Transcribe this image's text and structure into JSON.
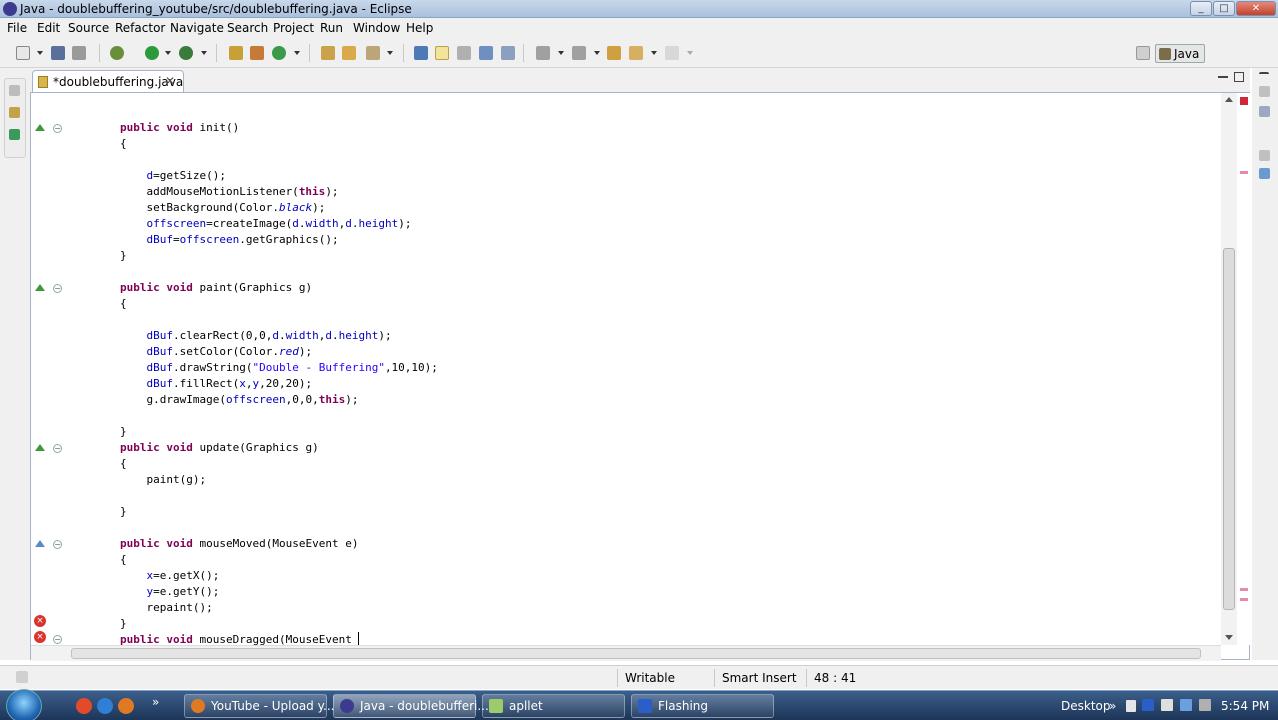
{
  "window": {
    "title": "Java - doublebuffering_youtube/src/doublebuffering.java - Eclipse",
    "minimize": "_",
    "maximize": "□",
    "close": "✕"
  },
  "menu": [
    "File",
    "Edit",
    "Source",
    "Refactor",
    "Navigate",
    "Search",
    "Project",
    "Run",
    "Window",
    "Help"
  ],
  "perspective": {
    "label": "Java"
  },
  "editor_tab": {
    "label": "*doublebuffering.java",
    "close": "✕"
  },
  "code": [
    {
      "t": 127,
      "parts": [
        [
          "kw",
          "public"
        ],
        [
          "p",
          " "
        ],
        [
          "kw",
          "void"
        ],
        [
          "p",
          " init()"
        ]
      ]
    },
    {
      "t": 143,
      "parts": [
        [
          "p",
          "{"
        ]
      ]
    },
    {
      "t": 175,
      "parts": [
        [
          "p",
          "    "
        ],
        [
          "fld",
          "d"
        ],
        [
          "p",
          "=getSize();"
        ]
      ]
    },
    {
      "t": 191,
      "parts": [
        [
          "p",
          "    addMouseMotionListener("
        ],
        [
          "kw",
          "this"
        ],
        [
          "p",
          ");"
        ]
      ]
    },
    {
      "t": 207,
      "parts": [
        [
          "p",
          "    setBackground(Color."
        ],
        [
          "ital",
          "black"
        ],
        [
          "p",
          ");"
        ]
      ]
    },
    {
      "t": 223,
      "parts": [
        [
          "p",
          "    "
        ],
        [
          "fld",
          "offscreen"
        ],
        [
          "p",
          "=createImage("
        ],
        [
          "fld",
          "d"
        ],
        [
          "p",
          "."
        ],
        [
          "fld",
          "width"
        ],
        [
          "p",
          ","
        ],
        [
          "fld",
          "d"
        ],
        [
          "p",
          "."
        ],
        [
          "fld",
          "height"
        ],
        [
          "p",
          ");"
        ]
      ]
    },
    {
      "t": 239,
      "parts": [
        [
          "p",
          "    "
        ],
        [
          "fld",
          "dBuf"
        ],
        [
          "p",
          "="
        ],
        [
          "fld",
          "offscreen"
        ],
        [
          "p",
          ".getGraphics();"
        ]
      ]
    },
    {
      "t": 255,
      "parts": [
        [
          "p",
          "}"
        ]
      ]
    },
    {
      "t": 287,
      "parts": [
        [
          "kw",
          "public"
        ],
        [
          "p",
          " "
        ],
        [
          "kw",
          "void"
        ],
        [
          "p",
          " paint(Graphics g)"
        ]
      ]
    },
    {
      "t": 303,
      "parts": [
        [
          "p",
          "{"
        ]
      ]
    },
    {
      "t": 335,
      "parts": [
        [
          "p",
          "    "
        ],
        [
          "fld",
          "dBuf"
        ],
        [
          "p",
          ".clearRect(0,0,"
        ],
        [
          "fld",
          "d"
        ],
        [
          "p",
          "."
        ],
        [
          "fld",
          "width"
        ],
        [
          "p",
          ","
        ],
        [
          "fld",
          "d"
        ],
        [
          "p",
          "."
        ],
        [
          "fld",
          "height"
        ],
        [
          "p",
          ");"
        ]
      ]
    },
    {
      "t": 351,
      "parts": [
        [
          "p",
          "    "
        ],
        [
          "fld",
          "dBuf"
        ],
        [
          "p",
          ".setColor(Color."
        ],
        [
          "ital",
          "red"
        ],
        [
          "p",
          ");"
        ]
      ]
    },
    {
      "t": 367,
      "parts": [
        [
          "p",
          "    "
        ],
        [
          "fld",
          "dBuf"
        ],
        [
          "p",
          ".drawString("
        ],
        [
          "str",
          "\"Double - Buffering\""
        ],
        [
          "p",
          ",10,10);"
        ]
      ]
    },
    {
      "t": 383,
      "parts": [
        [
          "p",
          "    "
        ],
        [
          "fld",
          "dBuf"
        ],
        [
          "p",
          ".fillRect("
        ],
        [
          "fld",
          "x"
        ],
        [
          "p",
          ","
        ],
        [
          "fld",
          "y"
        ],
        [
          "p",
          ",20,20);"
        ]
      ]
    },
    {
      "t": 399,
      "parts": [
        [
          "p",
          "    g.drawImage("
        ],
        [
          "fld",
          "offscreen"
        ],
        [
          "p",
          ",0,0,"
        ],
        [
          "kw",
          "this"
        ],
        [
          "p",
          ");"
        ]
      ]
    },
    {
      "t": 431,
      "parts": [
        [
          "p",
          "}"
        ]
      ]
    },
    {
      "t": 447,
      "parts": [
        [
          "kw",
          "public"
        ],
        [
          "p",
          " "
        ],
        [
          "kw",
          "void"
        ],
        [
          "p",
          " update(Graphics g)"
        ]
      ]
    },
    {
      "t": 463,
      "parts": [
        [
          "p",
          "{"
        ]
      ]
    },
    {
      "t": 479,
      "parts": [
        [
          "p",
          "    paint(g);"
        ]
      ]
    },
    {
      "t": 511,
      "parts": [
        [
          "p",
          "}"
        ]
      ]
    },
    {
      "t": 543,
      "parts": [
        [
          "kw",
          "public"
        ],
        [
          "p",
          " "
        ],
        [
          "kw",
          "void"
        ],
        [
          "p",
          " mouseMoved(MouseEvent e)"
        ]
      ]
    },
    {
      "t": 559,
      "parts": [
        [
          "p",
          "{"
        ]
      ]
    },
    {
      "t": 575,
      "parts": [
        [
          "p",
          "    "
        ],
        [
          "fld",
          "x"
        ],
        [
          "p",
          "=e.getX();"
        ]
      ]
    },
    {
      "t": 591,
      "parts": [
        [
          "p",
          "    "
        ],
        [
          "fld",
          "y"
        ],
        [
          "p",
          "=e.getY();"
        ]
      ]
    },
    {
      "t": 607,
      "parts": [
        [
          "p",
          "    repaint();"
        ]
      ]
    },
    {
      "t": 623,
      "parts": [
        [
          "p",
          "}"
        ]
      ]
    },
    {
      "t": 639,
      "parts": [
        [
          "kw",
          "public"
        ],
        [
          "p",
          " "
        ],
        [
          "kw",
          "void"
        ],
        [
          "p",
          " mouseDragged(MouseEvent "
        ]
      ]
    }
  ],
  "status": {
    "writable": "Writable",
    "insert_mode": "Smart Insert",
    "position": "48 : 41"
  },
  "taskbar": {
    "windows": [
      {
        "label": "YouTube - Upload y...",
        "icon": "firefox-icon"
      },
      {
        "label": "Java - doublebufferi...",
        "icon": "eclipse-icon"
      },
      {
        "label": "apllet",
        "icon": "notepad-icon"
      },
      {
        "label": "Flashing",
        "icon": "applet-icon"
      }
    ],
    "overflow": "»",
    "desktop": "Desktop",
    "time": "5:54 PM"
  }
}
